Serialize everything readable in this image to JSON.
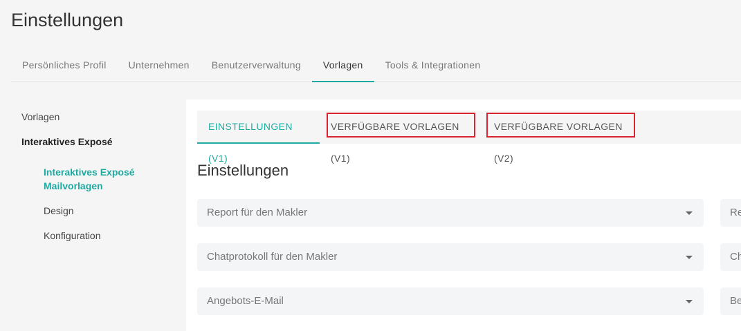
{
  "page": {
    "title": "Einstellungen"
  },
  "main_tabs": [
    {
      "label": "Persönliches Profil"
    },
    {
      "label": "Unternehmen"
    },
    {
      "label": "Benutzerverwaltung"
    },
    {
      "label": "Vorlagen"
    },
    {
      "label": "Tools & Integrationen"
    }
  ],
  "sidebar": {
    "items": [
      {
        "label": "Vorlagen"
      },
      {
        "label": "Interaktives Exposé"
      },
      {
        "label": "Interaktives Exposé Mailvorlagen"
      },
      {
        "label": "Design"
      },
      {
        "label": "Konfiguration"
      }
    ]
  },
  "sub_tabs": [
    {
      "label": "EINSTELLUNGEN (V1)"
    },
    {
      "label": "VERFÜGBARE VORLAGEN (V1)"
    },
    {
      "label": "VERFÜGBARE VORLAGEN (V2)"
    }
  ],
  "section": {
    "title": "Einstellungen"
  },
  "selects_left": [
    {
      "value": "Report für den Makler"
    },
    {
      "value": "Chatprotokoll für den Makler"
    },
    {
      "value": "Angebots-E-Mail"
    }
  ],
  "selects_right": [
    {
      "value": "Re"
    },
    {
      "value": "Ch"
    },
    {
      "value": "Be"
    }
  ],
  "colors": {
    "accent": "#1eaaa0",
    "highlight": "#d9232e"
  }
}
